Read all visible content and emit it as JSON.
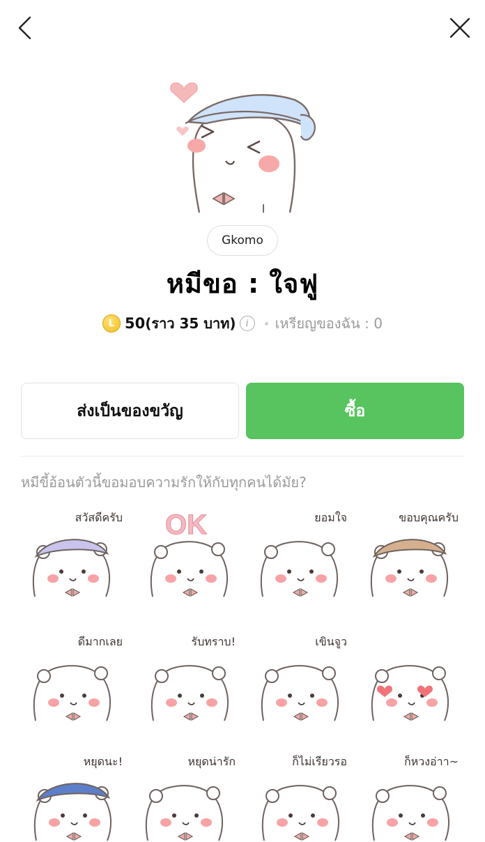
{
  "nav": {
    "back_icon": "chevron-left-icon",
    "close_icon": "close-icon"
  },
  "product": {
    "creator": "Gkomo",
    "title": "หมีขอ : ใจฟู",
    "coin_label": "L",
    "price": "50",
    "price_approx": "(ราว 35 บาท)",
    "my_coins": "เหรียญของฉัน : 0",
    "description": "หมีขี้อ้อนตัวนี้ขอมอบความรักให้กับทุกคนได้มัย?"
  },
  "actions": {
    "gift_label": "ส่งเป็นของขวัญ",
    "buy_label": "ซื้อ"
  },
  "colors": {
    "accent": "#57c45f",
    "muted_text": "#9a9a9a"
  },
  "stickers": [
    {
      "caption": "สวัสดีครับ"
    },
    {
      "caption": "OK"
    },
    {
      "caption": "ยอมใจ"
    },
    {
      "caption": "ขอบคุณครับ"
    },
    {
      "caption": "ดีมากเลย"
    },
    {
      "caption": "รับทราบ!"
    },
    {
      "caption": "เขินจูว"
    },
    {
      "caption": ""
    },
    {
      "caption": "หยุดนะ!"
    },
    {
      "caption": "หยุดน่ารัก"
    },
    {
      "caption": "ก็ไม่เรียวรอ"
    },
    {
      "caption": "ก็หวงอ่าา~"
    }
  ]
}
